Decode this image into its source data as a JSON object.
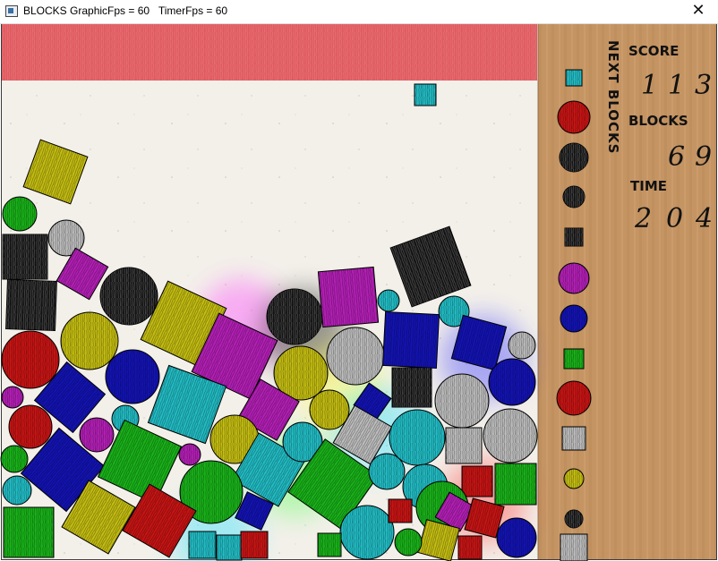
{
  "window": {
    "title": "BLOCKS GraphicFps = 60   TimerFps = 60",
    "close_glyph": "✕",
    "app_icon": "window-icon"
  },
  "hud": {
    "next_label": "NEXT BLOCKS",
    "score_label": "SCORE",
    "score_digits": [
      "1",
      "1",
      "3"
    ],
    "blocks_label": "BLOCKS",
    "blocks_digits": [
      "6",
      "9"
    ],
    "time_label": "TIME",
    "time_digits": [
      "2",
      "0",
      "4"
    ]
  },
  "colors": {
    "red_bar": "#e05a5f",
    "paper": "#f3f0ea",
    "cardboard": "#c49463",
    "yellow": "#c4bd12",
    "cyan": "#22bcc4",
    "magenta": "#b41fb6",
    "blue": "#1313b4",
    "green": "#19b219",
    "red": "#c81414",
    "black": "#121212",
    "gray": "#bdbdbd"
  },
  "next_blocks": [
    {
      "shape": "square",
      "color": "cyan"
    },
    {
      "shape": "circle",
      "color": "red"
    },
    {
      "shape": "circle",
      "color": "black"
    },
    {
      "shape": "circle",
      "color": "black"
    },
    {
      "shape": "square",
      "color": "black"
    },
    {
      "shape": "circle",
      "color": "magenta"
    },
    {
      "shape": "circle",
      "color": "blue"
    },
    {
      "shape": "square",
      "color": "green"
    },
    {
      "shape": "circle",
      "color": "red"
    },
    {
      "shape": "square",
      "color": "gray"
    },
    {
      "shape": "circle",
      "color": "yellow"
    },
    {
      "shape": "circle",
      "color": "black"
    },
    {
      "shape": "square",
      "color": "gray"
    }
  ],
  "falling_block": {
    "shape": "square",
    "color": "cyan"
  },
  "pile": [
    {
      "shape": "square",
      "color": "yellow",
      "rot": 20
    },
    {
      "shape": "circle",
      "color": "green"
    },
    {
      "shape": "square",
      "color": "black",
      "rot": 0
    },
    {
      "shape": "circle",
      "color": "gray"
    },
    {
      "shape": "square",
      "color": "magenta",
      "rot": 30
    },
    {
      "shape": "square",
      "color": "black",
      "rot": 2
    },
    {
      "shape": "circle",
      "color": "black"
    },
    {
      "shape": "square",
      "color": "yellow",
      "rot": 25
    },
    {
      "shape": "circle",
      "color": "black"
    },
    {
      "shape": "square",
      "color": "magenta",
      "rot": -5
    },
    {
      "shape": "square",
      "color": "black",
      "rot": -20
    },
    {
      "shape": "circle",
      "color": "cyan"
    },
    {
      "shape": "circle",
      "color": "cyan"
    },
    {
      "shape": "circle",
      "color": "red"
    },
    {
      "shape": "circle",
      "color": "yellow"
    },
    {
      "shape": "square",
      "color": "magenta",
      "rot": 25
    },
    {
      "shape": "circle",
      "color": "yellow"
    },
    {
      "shape": "circle",
      "color": "gray"
    },
    {
      "shape": "square",
      "color": "blue",
      "rot": 3
    },
    {
      "shape": "square",
      "color": "blue",
      "rot": 15
    },
    {
      "shape": "circle",
      "color": "gray"
    },
    {
      "shape": "circle",
      "color": "blue"
    },
    {
      "shape": "square",
      "color": "blue",
      "rot": 40
    },
    {
      "shape": "circle",
      "color": "blue"
    },
    {
      "shape": "square",
      "color": "cyan",
      "rot": 20
    },
    {
      "shape": "square",
      "color": "magenta",
      "rot": 30
    },
    {
      "shape": "square",
      "color": "black",
      "rot": 0
    },
    {
      "shape": "circle",
      "color": "gray"
    },
    {
      "shape": "square",
      "color": "blue",
      "rot": 35
    },
    {
      "shape": "circle",
      "color": "magenta"
    },
    {
      "shape": "circle",
      "color": "red"
    },
    {
      "shape": "circle",
      "color": "cyan"
    },
    {
      "shape": "circle",
      "color": "magenta"
    },
    {
      "shape": "circle",
      "color": "yellow"
    },
    {
      "shape": "circle",
      "color": "yellow"
    },
    {
      "shape": "square",
      "color": "gray",
      "rot": 30
    },
    {
      "shape": "circle",
      "color": "cyan"
    },
    {
      "shape": "circle",
      "color": "gray"
    },
    {
      "shape": "square",
      "color": "blue",
      "rot": 40
    },
    {
      "shape": "circle",
      "color": "green"
    },
    {
      "shape": "square",
      "color": "green",
      "rot": 25
    },
    {
      "shape": "circle",
      "color": "magenta"
    },
    {
      "shape": "square",
      "color": "cyan",
      "rot": 30
    },
    {
      "shape": "circle",
      "color": "cyan"
    },
    {
      "shape": "square",
      "color": "gray",
      "rot": 0
    },
    {
      "shape": "circle",
      "color": "green"
    },
    {
      "shape": "circle",
      "color": "cyan"
    },
    {
      "shape": "square",
      "color": "green",
      "rot": 35
    },
    {
      "shape": "circle",
      "color": "cyan"
    },
    {
      "shape": "circle",
      "color": "cyan"
    },
    {
      "shape": "square",
      "color": "red",
      "rot": 0
    },
    {
      "shape": "square",
      "color": "green",
      "rot": 0
    },
    {
      "shape": "square",
      "color": "blue",
      "rot": 25
    },
    {
      "shape": "circle",
      "color": "green"
    },
    {
      "shape": "square",
      "color": "yellow",
      "rot": 30
    },
    {
      "shape": "square",
      "color": "red",
      "rot": 30
    },
    {
      "shape": "square",
      "color": "green",
      "rot": 0
    },
    {
      "shape": "circle",
      "color": "cyan"
    },
    {
      "shape": "square",
      "color": "cyan",
      "rot": 0
    },
    {
      "shape": "square",
      "color": "cyan",
      "rot": 0
    },
    {
      "shape": "square",
      "color": "red",
      "rot": 0
    },
    {
      "shape": "square",
      "color": "green",
      "rot": 0
    },
    {
      "shape": "square",
      "color": "red",
      "rot": 0
    },
    {
      "shape": "square",
      "color": "magenta",
      "rot": 30
    },
    {
      "shape": "square",
      "color": "red",
      "rot": 15
    },
    {
      "shape": "square",
      "color": "yellow",
      "rot": 15
    },
    {
      "shape": "circle",
      "color": "green"
    },
    {
      "shape": "square",
      "color": "red",
      "rot": 0
    },
    {
      "shape": "circle",
      "color": "blue"
    }
  ]
}
